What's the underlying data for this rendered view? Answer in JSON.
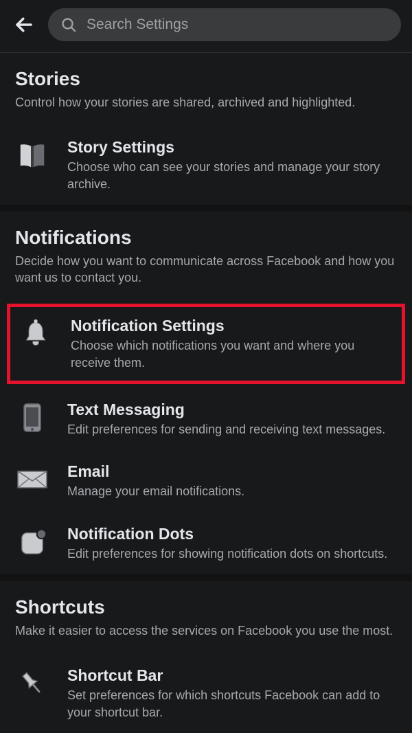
{
  "search": {
    "placeholder": "Search Settings"
  },
  "sections": {
    "stories": {
      "title": "Stories",
      "desc": "Control how your stories are shared, archived and highlighted.",
      "item": {
        "title": "Story Settings",
        "desc": "Choose who can see your stories and manage your story archive."
      }
    },
    "notifications": {
      "title": "Notifications",
      "desc": "Decide how you want to communicate across Facebook and how you want us to contact you.",
      "settings": {
        "title": "Notification Settings",
        "desc": "Choose which notifications you want and where you receive them."
      },
      "text": {
        "title": "Text Messaging",
        "desc": "Edit preferences for sending and receiving text messages."
      },
      "email": {
        "title": "Email",
        "desc": "Manage your email notifications."
      },
      "dots": {
        "title": "Notification Dots",
        "desc": "Edit preferences for showing notification dots on shortcuts."
      }
    },
    "shortcuts": {
      "title": "Shortcuts",
      "desc": "Make it easier to access the services on Facebook you use the most.",
      "bar": {
        "title": "Shortcut Bar",
        "desc": "Set preferences for which shortcuts Facebook can add to your shortcut bar."
      }
    }
  }
}
